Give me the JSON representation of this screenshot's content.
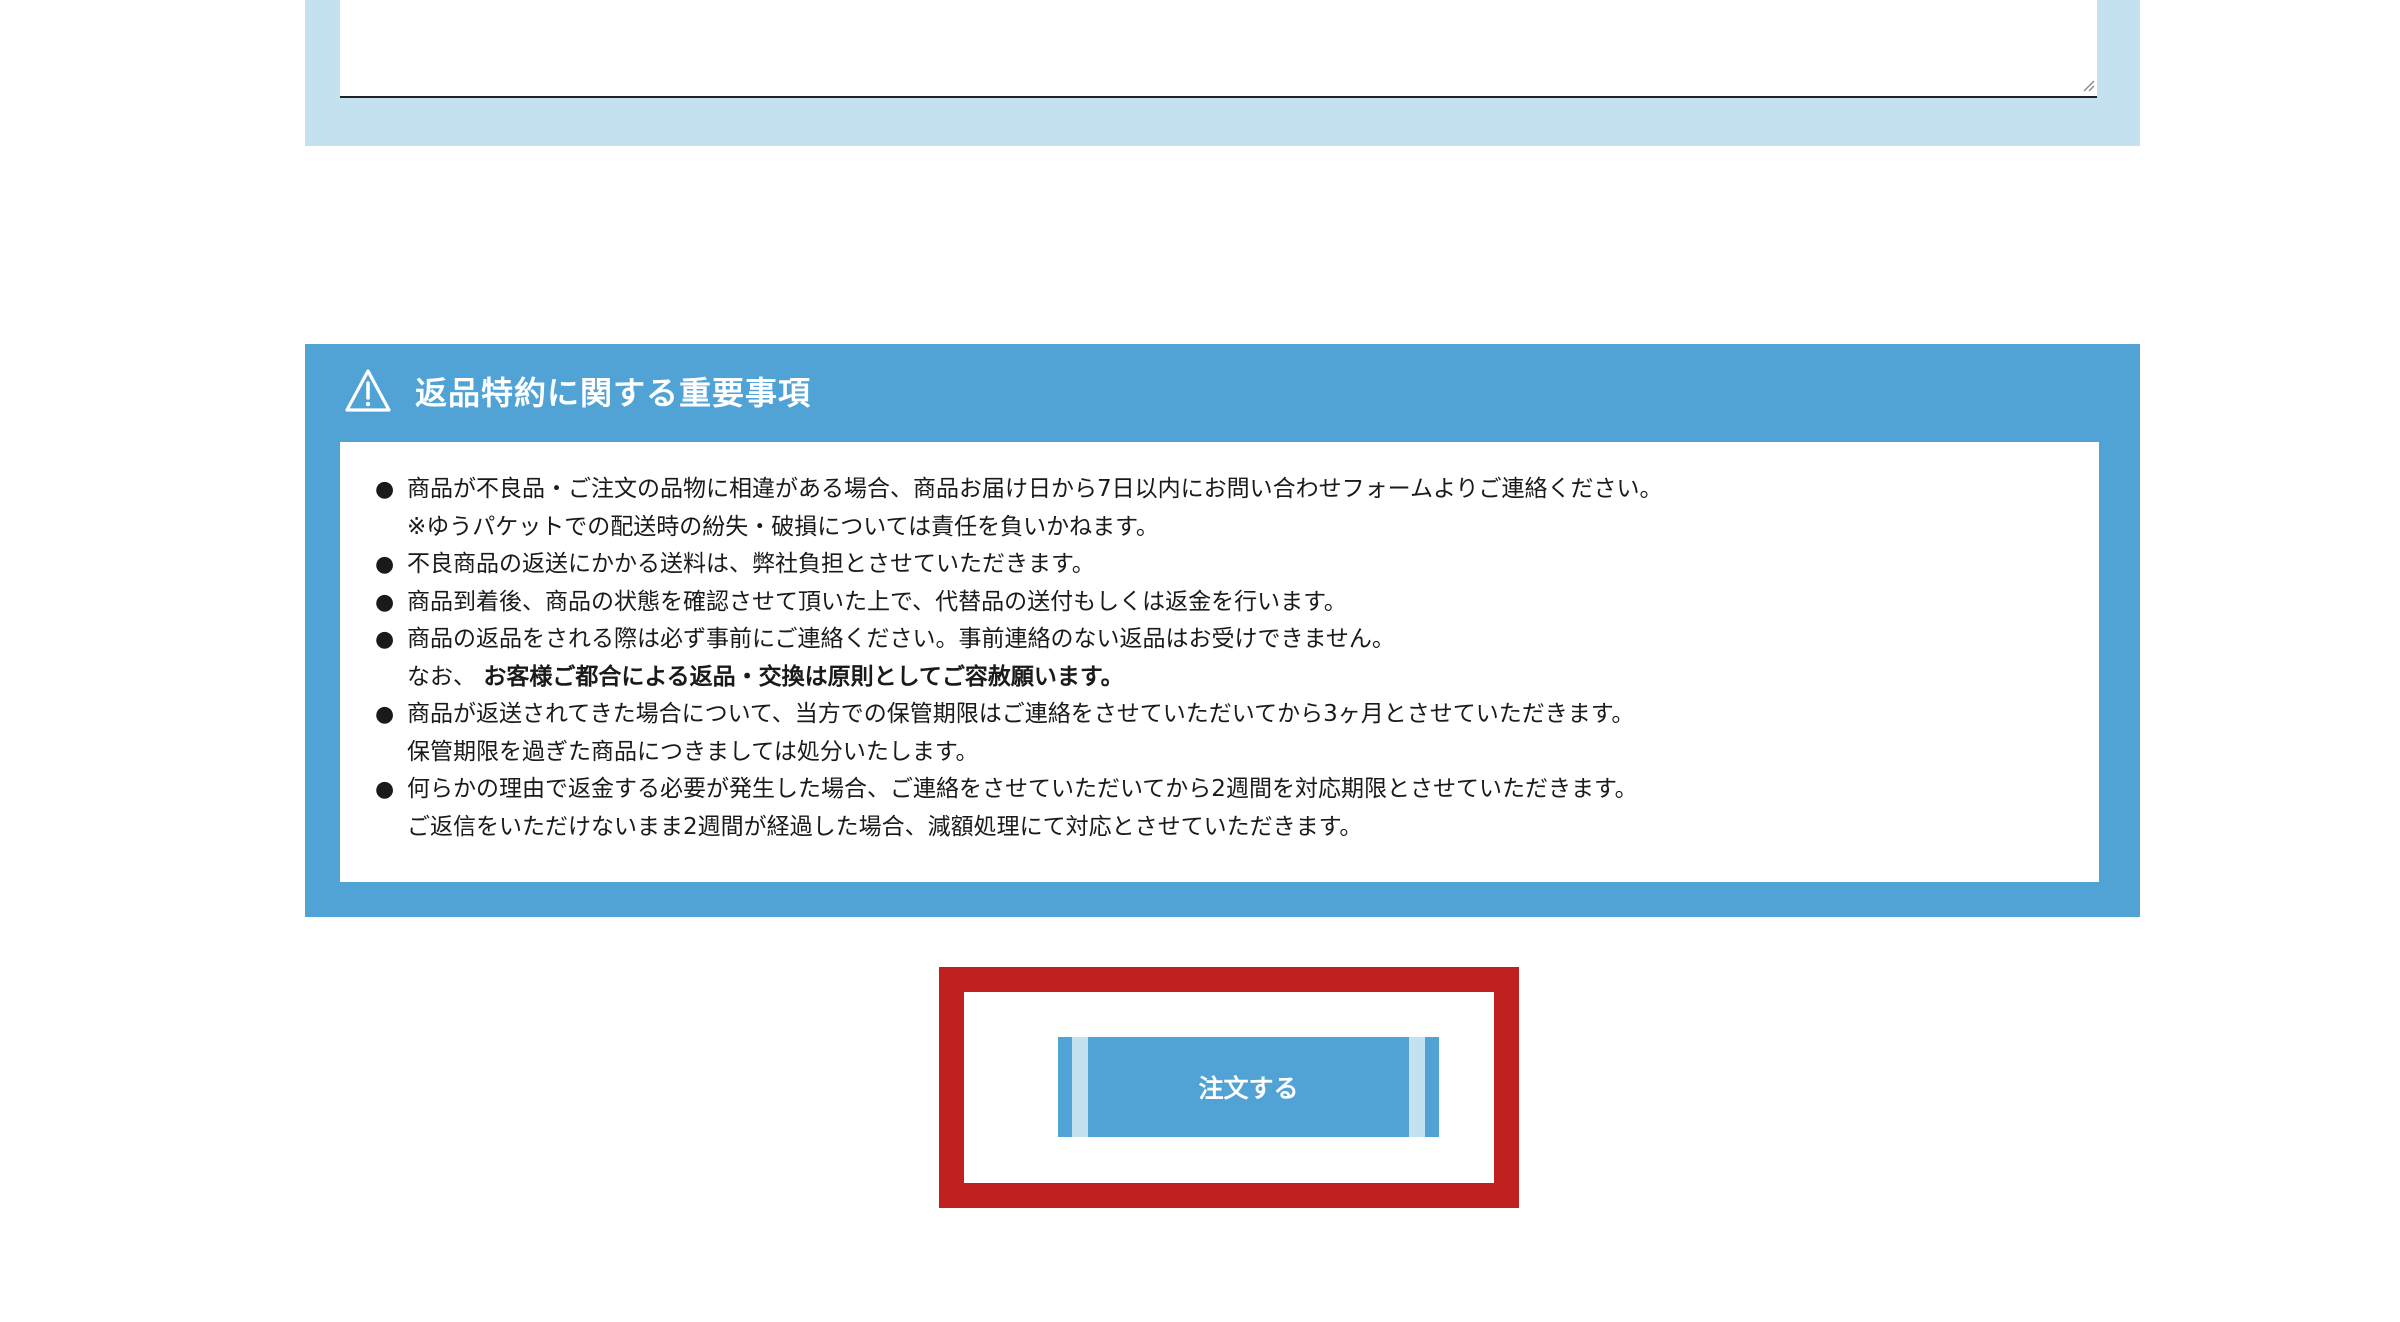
{
  "top_panel": {
    "textarea_value": ""
  },
  "notice": {
    "icon": "warning-triangle-icon",
    "title": "返品特約に関する重要事項",
    "bullet": "●",
    "items": [
      {
        "lines": [
          "商品が不良品・ご注文の品物に相違がある場合、商品お届け日から7日以内にお問い合わせフォームよりご連絡ください。",
          "※ゆうパケットでの配送時の紛失・破損については責任を負いかねます。"
        ]
      },
      {
        "lines": [
          "不良商品の返送にかかる送料は、弊社負担とさせていただきます。"
        ]
      },
      {
        "lines": [
          "商品到着後、商品の状態を確認させて頂いた上で、代替品の送付もしくは返金を行います。"
        ]
      },
      {
        "lines": [
          "商品の返品をされる際は必ず事前にご連絡ください。事前連絡のない返品はお受けできません。"
        ],
        "note_prefix": "なお、 ",
        "note_bold": "お客様ご都合による返品・交換は原則としてご容赦願います。"
      },
      {
        "lines": [
          "商品が返送されてきた場合について、当方での保管期限はご連絡をさせていただいてから3ヶ月とさせていただきます。",
          "保管期限を過ぎた商品につきましては処分いたします。"
        ]
      },
      {
        "lines": [
          "何らかの理由で返金する必要が発生した場合、ご連絡をさせていただいてから2週間を対応期限とさせていただきます。",
          "ご返信をいただけないまま2週間が経過した場合、減額処理にて対応とさせていただきます。"
        ]
      }
    ]
  },
  "order": {
    "button_label": "注文する"
  },
  "colors": {
    "panel_light_blue": "#c4e1f0",
    "panel_blue": "#51a3d6",
    "highlight_red": "#c0211f"
  }
}
